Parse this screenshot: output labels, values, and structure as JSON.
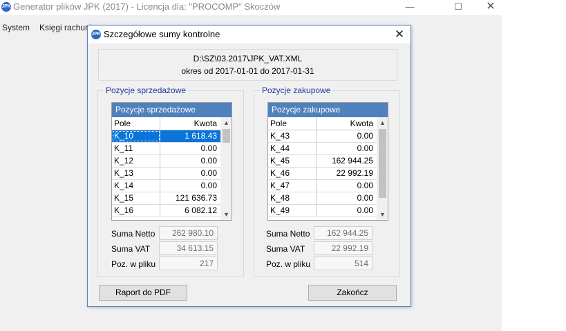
{
  "main_window": {
    "title": "Generator plików JPK (2017) - Licencja dla: \"PROCOMP\" Skoczów",
    "logo_text": "JPK",
    "controls": {
      "minimize": "—",
      "maximize": "☐",
      "close": "✕"
    },
    "menu": [
      "System",
      "Księgi rachunk"
    ]
  },
  "dialog": {
    "title": "Szczegółowe sumy kontrolne",
    "logo_text": "JPK",
    "close_glyph": "✕",
    "file_path": "D:\\SZ\\03.2017\\JPK_VAT.XML",
    "period": "okres od 2017-01-01 do 2017-01-31",
    "sales": {
      "legend": "Pozycje sprzedażowe",
      "caption": "Pozycje sprzedażowe",
      "headers": {
        "pole": "Pole",
        "kwota": "Kwota"
      },
      "rows": [
        {
          "pole": "K_10",
          "kwota": "1 618.43",
          "selected": true
        },
        {
          "pole": "K_11",
          "kwota": "0.00"
        },
        {
          "pole": "K_12",
          "kwota": "0.00"
        },
        {
          "pole": "K_13",
          "kwota": "0.00"
        },
        {
          "pole": "K_14",
          "kwota": "0.00"
        },
        {
          "pole": "K_15",
          "kwota": "121 636.73"
        },
        {
          "pole": "K_16",
          "kwota": "6 082.12"
        }
      ],
      "scroll_up": "▲",
      "scroll_down": "▼",
      "suma_netto_label": "Suma Netto",
      "suma_netto": "262 980.10",
      "suma_vat_label": "Suma VAT",
      "suma_vat": "34 613.15",
      "poz_label": "Poz. w pliku",
      "poz": "217"
    },
    "purchase": {
      "legend": "Pozycje zakupowe",
      "caption": "Pozycje zakupowe",
      "headers": {
        "pole": "Pole",
        "kwota": "Kwota"
      },
      "rows": [
        {
          "pole": "K_43",
          "kwota": "0.00"
        },
        {
          "pole": "K_44",
          "kwota": "0.00"
        },
        {
          "pole": "K_45",
          "kwota": "162 944.25"
        },
        {
          "pole": "K_46",
          "kwota": "22 992.19"
        },
        {
          "pole": "K_47",
          "kwota": "0.00"
        },
        {
          "pole": "K_48",
          "kwota": "0.00"
        },
        {
          "pole": "K_49",
          "kwota": "0.00"
        }
      ],
      "scroll_up": "▲",
      "scroll_down": "▼",
      "suma_netto_label": "Suma Netto",
      "suma_netto": "162 944.25",
      "suma_vat_label": "Suma VAT",
      "suma_vat": "22 992.19",
      "poz_label": "Poz. w pliku",
      "poz": "514"
    },
    "buttons": {
      "pdf": "Raport do PDF",
      "close": "Zakończ"
    }
  }
}
